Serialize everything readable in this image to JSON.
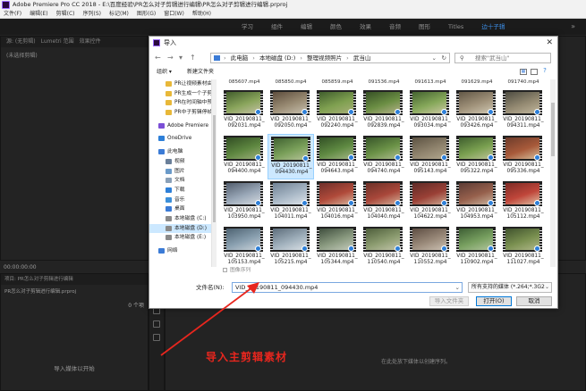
{
  "app": {
    "title": "Adobe Premiere Pro CC 2018 - E:\\百度经验\\PR怎么对子剪辑进行编辑\\PR怎么对子剪辑进行编辑.prproj",
    "menu": [
      "文件(F)",
      "编辑(E)",
      "剪辑(C)",
      "序列(S)",
      "标记(M)",
      "图形(G)",
      "窗口(W)",
      "帮助(H)"
    ],
    "workspaces": [
      "学习",
      "组件",
      "编辑",
      "颜色",
      "效果",
      "音频",
      "图形",
      "Titles",
      "边十子辑"
    ],
    "active_workspace": "边十子辑",
    "source_tabs": [
      "源: (无剪辑)",
      "Lumetri 范围",
      "效果控件"
    ],
    "source_empty": "(未选择剪辑)",
    "timecode": "00:00:00:00",
    "project_tab": "项目: PR怎么对子剪辑进行编辑",
    "project_file": "PR怎么对子剪辑进行编辑.prproj",
    "project_count": "0 个项",
    "project_hint": "导入媒体以开始",
    "timeline_hint": "在此处放下媒体以创建序列。"
  },
  "dialog": {
    "title": "导入",
    "close": "✕",
    "nav_buttons": [
      "←",
      "→",
      "▾",
      "↑"
    ],
    "breadcrumbs": [
      "此电脑",
      "本地磁盘 (D:)",
      "整理视频照片",
      "武当山"
    ],
    "search_placeholder": "搜索\"武当山\"",
    "organize": "组织 ▾",
    "new_folder": "新建文件夹",
    "nav_items": [
      {
        "label": "PR让视频素材由",
        "level": 1,
        "color": "#e8b839"
      },
      {
        "label": "PR生成一个子剪",
        "level": 1,
        "color": "#e8b839"
      },
      {
        "label": "PR在时间轴中预",
        "level": 1,
        "color": "#e8b839"
      },
      {
        "label": "PR中子剪辑停帧",
        "level": 1,
        "color": "#e8b839"
      },
      {
        "label": "Adobe Premiere",
        "level": 0,
        "color": "#7b4fd6",
        "gap": true
      },
      {
        "label": "OneDrive",
        "level": 0,
        "color": "#2d7fd8",
        "gap": true
      },
      {
        "label": "此电脑",
        "level": 0,
        "color": "#3b7bd6",
        "gap": true
      },
      {
        "label": "视频",
        "level": 1,
        "color": "#6a7f99"
      },
      {
        "label": "图片",
        "level": 1,
        "color": "#6a9ac9"
      },
      {
        "label": "文档",
        "level": 1,
        "color": "#8aa0b8"
      },
      {
        "label": "下载",
        "level": 1,
        "color": "#2d7fd8"
      },
      {
        "label": "音乐",
        "level": 1,
        "color": "#3c8fd9"
      },
      {
        "label": "桌面",
        "level": 1,
        "color": "#3b7bd6"
      },
      {
        "label": "本地磁盘 (C:)",
        "level": 1,
        "color": "#8a8a8a"
      },
      {
        "label": "本地磁盘 (D:)",
        "level": 1,
        "color": "#8a8a8a",
        "selected": true
      },
      {
        "label": "本地磁盘 (E:)",
        "level": 1,
        "color": "#8a8a8a"
      },
      {
        "label": "网络",
        "level": 0,
        "color": "#3b7bd6",
        "gap": true
      }
    ],
    "top_partial": [
      "085607.mp4",
      "085850.mp4",
      "085859.mp4",
      "091536.mp4",
      "091613.mp4",
      "091629.mp4",
      "091740.mp4"
    ],
    "files": [
      {
        "name": "VID_20190811_092031.mp4",
        "colors": [
          "#3f5a2a",
          "#8aa55c",
          "#c8c2a8"
        ]
      },
      {
        "name": "VID_20190811_092050.mp4",
        "colors": [
          "#5a4a3a",
          "#9a8c74",
          "#c9c2b1"
        ]
      },
      {
        "name": "VID_20190811_092240.mp4",
        "colors": [
          "#3e5b2c",
          "#7fa050",
          "#aab07a"
        ]
      },
      {
        "name": "VID_20190811_092839.mp4",
        "colors": [
          "#344d24",
          "#6c8f44",
          "#b9b38e"
        ]
      },
      {
        "name": "VID_20190811_093034.mp4",
        "colors": [
          "#41602e",
          "#86a85a",
          "#cfc9a7"
        ]
      },
      {
        "name": "VID_20190811_093426.mp4",
        "colors": [
          "#5f5444",
          "#a0927a",
          "#d3cbb6"
        ]
      },
      {
        "name": "VID_20190811_094311.mp4",
        "colors": [
          "#4b4a40",
          "#948a72",
          "#c4b99f"
        ]
      },
      {
        "name": "VID_20190811_094400.mp4",
        "colors": [
          "#2f4a22",
          "#5e8740",
          "#9fb07d"
        ]
      },
      {
        "name": "VID_20190811_094430.mp4",
        "colors": [
          "#3e6030",
          "#7aa05a",
          "#b8c49c"
        ],
        "selected": true
      },
      {
        "name": "VID_20190811_094643.mp4",
        "colors": [
          "#304d24",
          "#5f8a42",
          "#a6b888"
        ]
      },
      {
        "name": "VID_20190811_094740.mp4",
        "colors": [
          "#355228",
          "#6b9247",
          "#b1be91"
        ]
      },
      {
        "name": "VID_20190811_095143.mp4",
        "colors": [
          "#5a5040",
          "#8f836d",
          "#b3a98f"
        ]
      },
      {
        "name": "VID_20190811_095322.mp4",
        "colors": [
          "#3b5a2c",
          "#7aa050",
          "#c1c59c"
        ]
      },
      {
        "name": "VID_20190811_095336.mp4",
        "colors": [
          "#6a3a2a",
          "#a85a3a",
          "#d8c3a0"
        ]
      },
      {
        "name": "VID_20190811_103950.mp4",
        "colors": [
          "#4f5a6a",
          "#9aa8b8",
          "#d8dde2"
        ]
      },
      {
        "name": "VID_20190811_104011.mp4",
        "colors": [
          "#6d7f92",
          "#a9b8c6",
          "#e0e6ec"
        ]
      },
      {
        "name": "VID_20190811_104016.mp4",
        "colors": [
          "#6b2e2a",
          "#b04a3a",
          "#d9b9a0"
        ]
      },
      {
        "name": "VID_20190811_104040.mp4",
        "colors": [
          "#6a3027",
          "#a9473a",
          "#d6b59d"
        ]
      },
      {
        "name": "VID_20190811_104622.mp4",
        "colors": [
          "#5c2a26",
          "#9a4036",
          "#cfae96"
        ]
      },
      {
        "name": "VID_20190811_104953.mp4",
        "colors": [
          "#5a3a34",
          "#96604c",
          "#cdb8a2"
        ]
      },
      {
        "name": "VID_20190811_105112.mp4",
        "colors": [
          "#7a2a24",
          "#c0463a",
          "#e0c6a8"
        ]
      },
      {
        "name": "VID_20190811_105153.mp4",
        "colors": [
          "#4a5f6e",
          "#8aa0b0",
          "#cfd7dd"
        ]
      },
      {
        "name": "VID_20190811_105215.mp4",
        "colors": [
          "#5a6a78",
          "#a0b0bc",
          "#dde3e8"
        ]
      },
      {
        "name": "VID_20190811_105344.mp4",
        "colors": [
          "#3b4a3a",
          "#8a9a80",
          "#c8cfc0"
        ]
      },
      {
        "name": "VID_20190811_110540.mp4",
        "colors": [
          "#4a5a38",
          "#8c9c70",
          "#c6c8ae"
        ]
      },
      {
        "name": "VID_20190811_110552.mp4",
        "colors": [
          "#5a4a40",
          "#9a8a7a",
          "#cfc4b6"
        ]
      },
      {
        "name": "VID_20190811_110902.mp4",
        "colors": [
          "#3a5a32",
          "#78a060",
          "#b6c8a2"
        ]
      },
      {
        "name": "VID_20190811_111027.mp4",
        "colors": [
          "#3d4f2c",
          "#7a9050",
          "#b4bb8e"
        ]
      }
    ],
    "image_sequence": "图像序列",
    "filename_label": "文件名(N):",
    "filename_value": "VID_20190811_094430.mp4",
    "filetype": "所有支持的媒体 (*.264;*.3G2;*",
    "import_folder": "导入文件夹",
    "open": "打开(O)",
    "cancel": "取消"
  },
  "annotation": {
    "text": "导入主剪辑素材",
    "color": "#e8261e"
  }
}
